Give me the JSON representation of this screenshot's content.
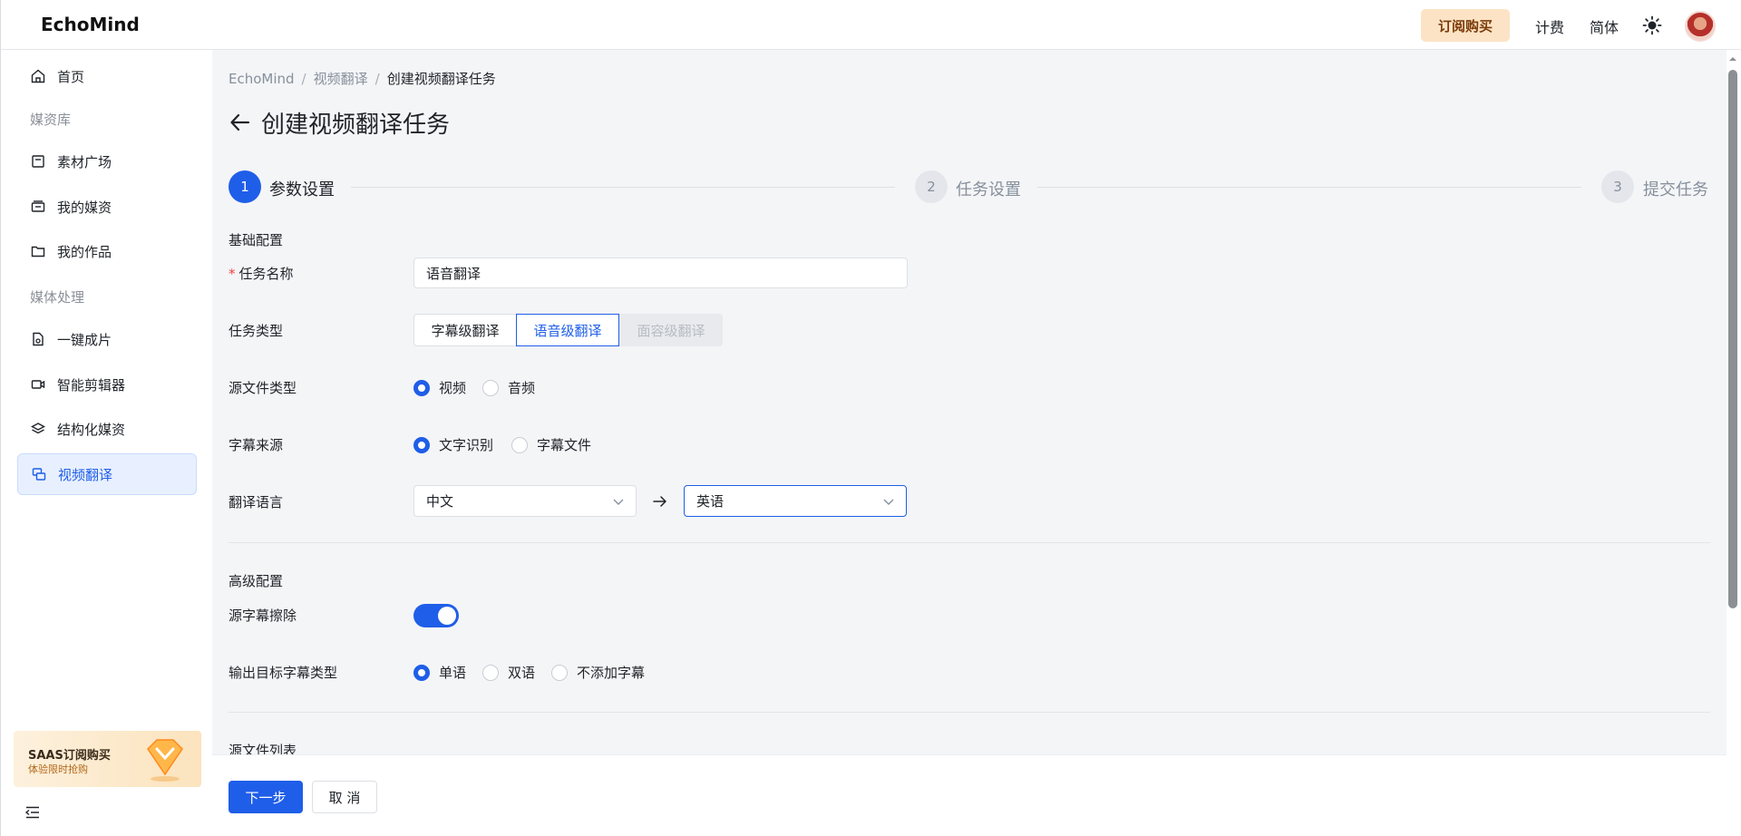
{
  "app": {
    "logo": "EchoMind"
  },
  "header": {
    "subscribe_label": "订阅购买",
    "billing_label": "计费",
    "language_label": "简体",
    "theme_icon": "sun-icon",
    "avatar_icon": "user-avatar"
  },
  "sidebar": {
    "home": "首页",
    "group_media": "媒资库",
    "material_square": "素材广场",
    "my_media": "我的媒资",
    "my_works": "我的作品",
    "group_processing": "媒体处理",
    "one_click": "一键成片",
    "smart_editor": "智能剪辑器",
    "structured_media": "结构化媒资",
    "video_translation": "视频翻译",
    "promo_title": "SAAS订阅购买",
    "promo_subtitle": "体验限时抢购"
  },
  "breadcrumb": {
    "root": "EchoMind",
    "parent": "视频翻译",
    "current": "创建视频翻译任务"
  },
  "page_title": "创建视频翻译任务",
  "steps": [
    {
      "num": "1",
      "label": "参数设置"
    },
    {
      "num": "2",
      "label": "任务设置"
    },
    {
      "num": "3",
      "label": "提交任务"
    }
  ],
  "basic_section": "基础配置",
  "form": {
    "task_name_label": "任务名称",
    "task_name_required": "*",
    "task_name_value": "语音翻译",
    "task_type_label": "任务类型",
    "task_types": [
      "字幕级翻译",
      "语音级翻译",
      "面容级翻译"
    ],
    "source_type_label": "源文件类型",
    "source_types": [
      "视频",
      "音频"
    ],
    "subtitle_source_label": "字幕来源",
    "subtitle_sources": [
      "文字识别",
      "字幕文件"
    ],
    "lang_label": "翻译语言",
    "source_lang": "中文",
    "target_lang": "英语"
  },
  "advanced_section": "高级配置",
  "advanced": {
    "erase_label": "源字幕擦除",
    "erase_on": true,
    "output_label": "输出目标字幕类型",
    "output_types": [
      "单语",
      "双语",
      "不添加字幕"
    ]
  },
  "file_list_section": "源文件列表",
  "footer": {
    "next_label": "下一步",
    "cancel_label": "取 消"
  },
  "colors": {
    "primary": "#1f5ee8",
    "subscribe_bg": "#fde3c5",
    "main_bg": "#f4f5f7"
  }
}
